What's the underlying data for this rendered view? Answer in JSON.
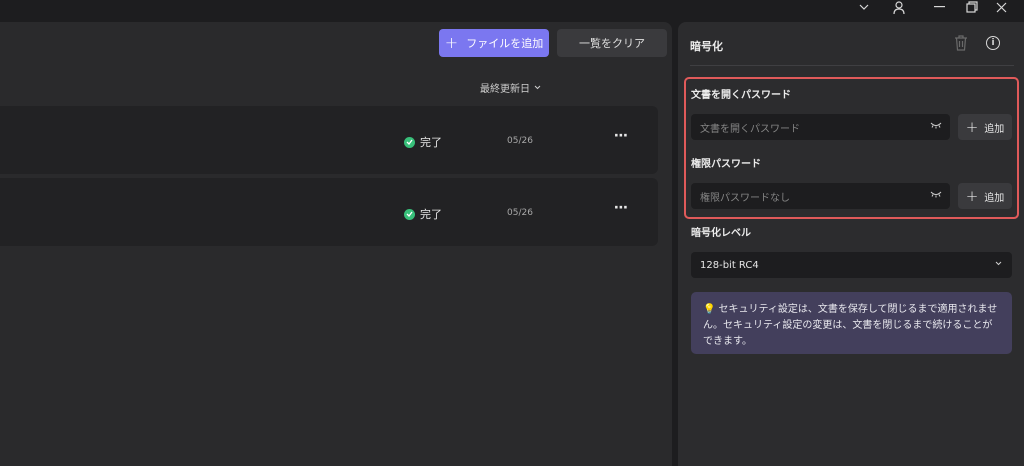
{
  "titlebar": {
    "icons": [
      "chevron-down-icon",
      "user-icon",
      "minimize-icon",
      "restore-icon",
      "close-icon"
    ]
  },
  "main": {
    "add_file_label": "ファイルを追加",
    "clear_list_label": "一覧をクリア",
    "sort_label": "最終更新日",
    "rows": [
      {
        "status": "完了",
        "date": "05/26",
        "more": "⋯"
      },
      {
        "status": "完了",
        "date": "05/26",
        "more": "⋯"
      }
    ]
  },
  "panel": {
    "title": "暗号化",
    "open_password": {
      "label": "文書を開くパスワード",
      "placeholder": "文書を開くパスワード",
      "add_label": "追加"
    },
    "permission_password": {
      "label": "権限パスワード",
      "placeholder": "権限パスワードなし",
      "add_label": "追加"
    },
    "encryption_level": {
      "label": "暗号化レベル",
      "selected": "128-bit RC4"
    },
    "notice": "セキュリティ設定は、文書を保存して閉じるまで適用されません。セキュリティ設定の変更は、文書を閉じるまで続けることができます。"
  },
  "colors": {
    "accent": "#7b77f0",
    "success": "#38c07a",
    "highlight": "#e05a5a",
    "notice_bg": "#433f5c"
  }
}
